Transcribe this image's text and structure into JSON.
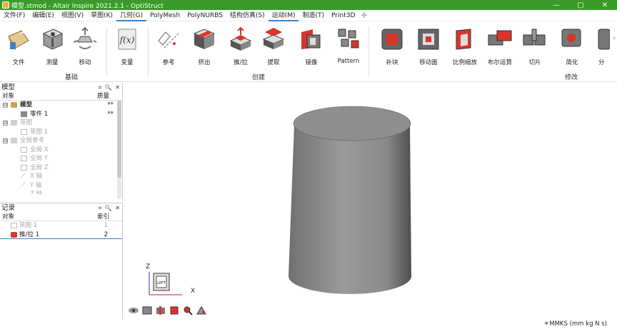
{
  "window": {
    "title": "模型.stmod - Altair Inspire 2021.2.1 - OptiStruct",
    "controls": {
      "minimize": "—",
      "maximize": "▢",
      "close": "✕"
    }
  },
  "menu": [
    {
      "label": "文件(F)"
    },
    {
      "label": "编辑(E)"
    },
    {
      "label": "视图(V)"
    },
    {
      "label": "草图(K)"
    },
    {
      "label": "几何(G)",
      "active": true
    },
    {
      "label": "PolyMesh"
    },
    {
      "label": "PolyNURBS"
    },
    {
      "label": "结构仿真(S)"
    },
    {
      "label": "运动(M)",
      "active": true
    },
    {
      "label": "制造(T)"
    },
    {
      "label": "Print3D"
    }
  ],
  "ribbon": {
    "groups": [
      {
        "label": "基础",
        "tools": [
          {
            "label": "文件",
            "icon": "file-icon"
          },
          {
            "label": "测量",
            "icon": "measure-icon"
          },
          {
            "label": "移动",
            "icon": "move-icon"
          }
        ]
      },
      {
        "label": "",
        "tools": [
          {
            "label": "变量",
            "icon": "variable-fx-icon"
          }
        ]
      },
      {
        "label": "创建",
        "tools": [
          {
            "label": "参考",
            "icon": "reference-icon"
          },
          {
            "label": "挤出",
            "icon": "extrude-icon"
          },
          {
            "label": "推/拉",
            "icon": "push-pull-icon"
          },
          {
            "label": "提取",
            "icon": "extract-icon"
          },
          {
            "label": "镜像",
            "icon": "mirror-icon"
          },
          {
            "label": "Pattern",
            "icon": "pattern-icon"
          }
        ]
      },
      {
        "label": "修改",
        "tools": [
          {
            "label": "补块",
            "icon": "patch-icon"
          },
          {
            "label": "移动面",
            "icon": "move-face-icon"
          },
          {
            "label": "比例缩放",
            "icon": "scale-icon"
          },
          {
            "label": "布尔运算",
            "icon": "boolean-icon"
          },
          {
            "label": "切片",
            "icon": "slice-icon"
          },
          {
            "label": "简化",
            "icon": "simplify-icon"
          },
          {
            "label": "分",
            "icon": "split-icon"
          }
        ]
      }
    ]
  },
  "model_panel": {
    "title": "模型",
    "tools": "⌗ 🔍 ✕",
    "col_object": "对象",
    "col_mass": "质量",
    "rows": [
      {
        "label": "模型",
        "value": "**",
        "bold": true,
        "expand": "⊟"
      },
      {
        "label": "零件 1",
        "value": "**"
      },
      {
        "label": "草图",
        "expand": "⊟",
        "gray": true
      },
      {
        "label": "草图 1",
        "gray": true
      },
      {
        "label": "全局参考",
        "expand": "⊟",
        "gray": true
      },
      {
        "label": "全局 X",
        "gray": true
      },
      {
        "label": "全局 Y",
        "gray": true
      },
      {
        "label": "全局 Z",
        "gray": true
      },
      {
        "label": "X 轴",
        "gray": true
      },
      {
        "label": "Y 轴",
        "gray": true
      },
      {
        "label": "Z 轴",
        "gray": true
      }
    ]
  },
  "record_panel": {
    "title": "记录",
    "tools": "⌗ 🔍 ✕",
    "col_object": "对象",
    "col_index": "索引",
    "rows": [
      {
        "label": "草图 1",
        "index": "1",
        "gray": true
      },
      {
        "label": "推/拉 1",
        "index": "2"
      }
    ]
  },
  "viewcube": {
    "face_label": "LEFT",
    "axis_z": "Z",
    "axis_x": "X"
  },
  "status": {
    "units": "MMKS (mm kg N s)"
  },
  "colors": {
    "titlebar": "#3a9a2a",
    "accent_red": "#d9342b",
    "cylinder": "#8a8a8a"
  }
}
